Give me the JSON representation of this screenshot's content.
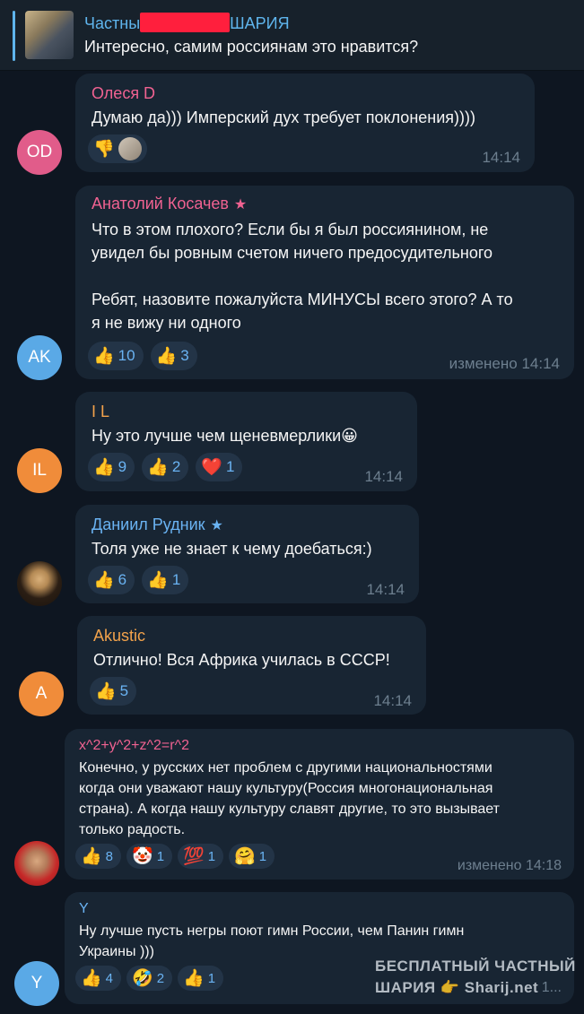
{
  "pinned": {
    "title_start": "Частны",
    "title_end": "ШАРИЯ",
    "text": "Интересно, самим россиянам это нравится?"
  },
  "colors": {
    "background": "#0e1621",
    "bubble": "#182533",
    "accent": "#6ab3f3",
    "time": "#6d7f8f"
  },
  "messages": [
    {
      "avatar": "OD",
      "avatar_color": "#e15c8a",
      "name": "Олеся D",
      "name_color": "#f06291",
      "text": "Думаю да))) Имперский дух требует поклонения))))",
      "reactions": [
        {
          "emoji": "👎",
          "icon": "thumbs-down-icon"
        }
      ],
      "time": "14:14"
    },
    {
      "avatar": "AK",
      "avatar_color": "#5aa9e6",
      "name": "Анатолий Косачев",
      "name_color": "#f06291",
      "star": "★",
      "text1": "Что в этом плохого? Если бы я был россиянином, не",
      "text2": "увидел бы ровным счетом ничего предосудительного",
      "text3": "Ребят, назовите пожалуйста МИНУСЫ всего этого? А то",
      "text4": "я не вижу ни одного",
      "reactions": [
        {
          "emoji": "👍",
          "count": "10"
        },
        {
          "emoji": "👍",
          "count": "3"
        }
      ],
      "time": "изменено 14:14"
    },
    {
      "avatar": "IL",
      "avatar_color": "#f08c3a",
      "name": "I L",
      "name_color": "#f2a24b",
      "text": "Ну это лучше чем щеневмерлики😀",
      "reactions": [
        {
          "emoji": "👍",
          "count": "9"
        },
        {
          "emoji": "👍",
          "count": "2"
        },
        {
          "emoji": "❤️",
          "count": "1"
        }
      ],
      "time": "14:14"
    },
    {
      "avatar": "",
      "name": "Даниил Рудник",
      "name_color": "#6ab3f3",
      "star": "★",
      "text": "Толя уже не знает к чему доебаться:)",
      "reactions": [
        {
          "emoji": "👍",
          "count": "6"
        },
        {
          "emoji": "👍",
          "count": "1"
        }
      ],
      "time": "14:14"
    },
    {
      "avatar": "A",
      "avatar_color": "#f08c3a",
      "name": "Akustic",
      "name_color": "#f2a24b",
      "text": "Отлично! Вся Африка училась в СССР!",
      "reactions": [
        {
          "emoji": "👍",
          "count": "5"
        }
      ],
      "time": "14:14"
    },
    {
      "avatar": "",
      "name": "x^2+y^2+z^2=r^2",
      "name_color": "#f06291",
      "text1": "Конечно, у русских нет проблем с другими национальностями",
      "text2": "когда они уважают нашу культуру(Россия многонациональная",
      "text3": "страна). А когда нашу культуру славят другие, то это вызывает",
      "text4": "только радость.",
      "reactions": [
        {
          "emoji": "👍",
          "count": "8"
        },
        {
          "emoji": "🤡",
          "count": "1"
        },
        {
          "emoji": "💯",
          "count": "1"
        },
        {
          "emoji": "🤗",
          "count": "1"
        }
      ],
      "time": "изменено 14:18"
    },
    {
      "avatar": "Y",
      "avatar_color": "#5aa9e6",
      "name": "Y",
      "name_color": "#6ab3f3",
      "text1": "Ну лучше пусть негры поют гимн России, чем Панин гимн",
      "text2": "Украины )))",
      "reactions": [
        {
          "emoji": "👍",
          "count": "4"
        },
        {
          "emoji": "🤣",
          "count": "2"
        },
        {
          "emoji": "👍",
          "count": "1"
        }
      ],
      "time": "1..."
    }
  ],
  "watermark": {
    "line1": "БЕСПЛАТНЫЙ ЧАСТНЫЙ",
    "line2": "ШАРИЯ 👉 Sharij.net"
  }
}
